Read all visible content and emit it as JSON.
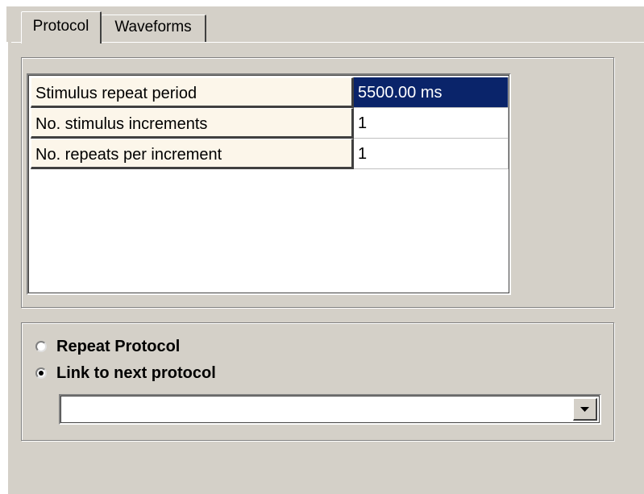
{
  "tabs": [
    {
      "label": "Protocol",
      "active": true
    },
    {
      "label": "Waveforms",
      "active": false
    }
  ],
  "parameters": [
    {
      "label": "Stimulus repeat period",
      "value": "5500.00 ms",
      "selected": true
    },
    {
      "label": "No. stimulus increments",
      "value": "1",
      "selected": false
    },
    {
      "label": "No. repeats per increment",
      "value": "1",
      "selected": false
    }
  ],
  "options": {
    "repeat_protocol": {
      "label": "Repeat Protocol",
      "checked": false
    },
    "link_to_next": {
      "label": "Link to next protocol",
      "checked": true
    }
  },
  "next_protocol_select": {
    "value": ""
  },
  "colors": {
    "face": "#d4d0c8",
    "selection": "#0a246a",
    "label_cell": "#fcf6ea"
  }
}
